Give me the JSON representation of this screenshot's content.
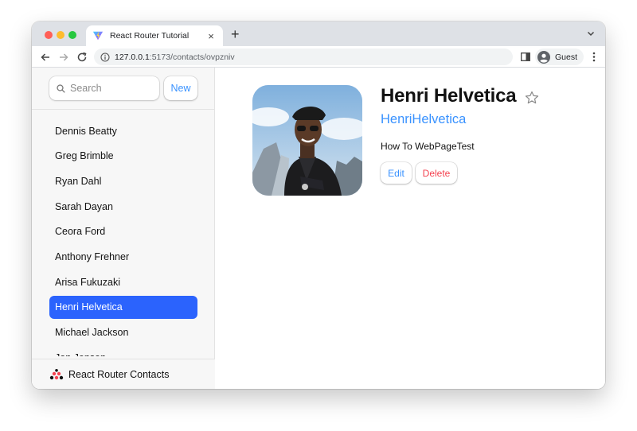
{
  "browser": {
    "tab_title": "React Router Tutorial",
    "tab_close": "×",
    "new_tab": "+",
    "url_host": "127.0.0.1",
    "url_path": ":5173/contacts/ovpzniv",
    "profile_label": "Guest"
  },
  "sidebar": {
    "search_placeholder": "Search",
    "new_label": "New",
    "contacts": [
      {
        "name": "Dennis Beatty",
        "active": false
      },
      {
        "name": "Greg Brimble",
        "active": false
      },
      {
        "name": "Ryan Dahl",
        "active": false
      },
      {
        "name": "Sarah Dayan",
        "active": false
      },
      {
        "name": "Ceora Ford",
        "active": false
      },
      {
        "name": "Anthony Frehner",
        "active": false
      },
      {
        "name": "Arisa Fukuzaki",
        "active": false
      },
      {
        "name": "Henri Helvetica",
        "active": true
      },
      {
        "name": "Michael Jackson",
        "active": false
      },
      {
        "name": "Jon Jensen",
        "active": false
      }
    ],
    "footer_title": "React Router Contacts"
  },
  "contact": {
    "name": "Henri Helvetica",
    "twitter": "HenriHelvetica",
    "notes": "How To WebPageTest",
    "edit_label": "Edit",
    "delete_label": "Delete",
    "favorite": false
  },
  "icons": {
    "tab_favicon": "vite-icon",
    "back": "back-arrow-icon",
    "forward": "forward-arrow-icon",
    "reload": "reload-icon",
    "site_info": "info-icon",
    "side_panel": "side-panel-icon",
    "profile": "profile-avatar-icon",
    "menu": "kebab-menu-icon",
    "search": "search-icon",
    "favorite": "star-icon",
    "logo": "react-router-logo-icon"
  },
  "colors": {
    "accent": "#3992ff",
    "active_item": "#2e63fc",
    "danger": "#f44250",
    "sidebar_bg": "#f7f7f7"
  }
}
